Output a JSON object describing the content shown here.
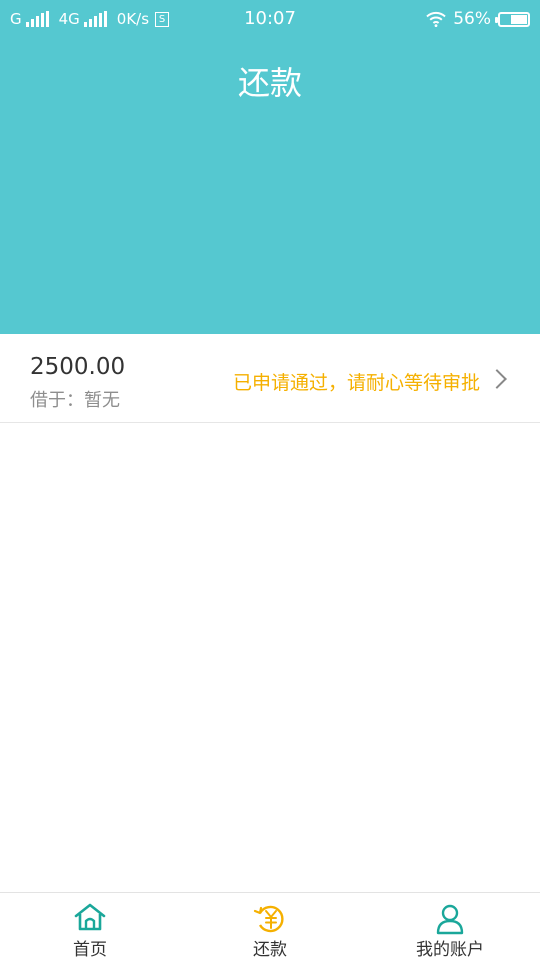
{
  "status_bar": {
    "carrier1": "G",
    "carrier2": "4G",
    "speed": "0K/s",
    "sim_badge": "S",
    "time": "10:07",
    "battery": "56%",
    "battery_level": 0.56
  },
  "header": {
    "title": "还款",
    "bg_color": "#55c8d0"
  },
  "loan_item": {
    "amount": "2500.00",
    "lender": "借于：暂无",
    "status": "已申请通过，请耐心等待审批",
    "status_color": "#f5b000"
  },
  "tabbar": {
    "tabs": [
      {
        "label": "首页",
        "icon": "home-icon"
      },
      {
        "label": "还款",
        "icon": "repay-yen-icon",
        "active": true
      },
      {
        "label": "我的账户",
        "icon": "user-icon"
      }
    ]
  }
}
